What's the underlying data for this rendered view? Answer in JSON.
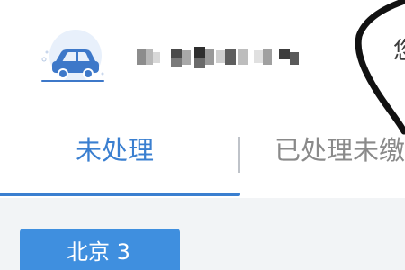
{
  "header": {
    "avatar_icon": "car-icon",
    "plate_number": "",
    "side_text": "您"
  },
  "tabs": [
    {
      "label": "未处理",
      "active": true
    },
    {
      "label": "已处理未缴",
      "active": false
    }
  ],
  "city_filter": {
    "label": "北京 3"
  },
  "colors": {
    "accent": "#3a7fd0",
    "button_bg": "#3f8fdf",
    "inactive_tab": "#8a8a8a",
    "page_bg": "#f2f4f6",
    "car_icon": "#3d78c9"
  }
}
